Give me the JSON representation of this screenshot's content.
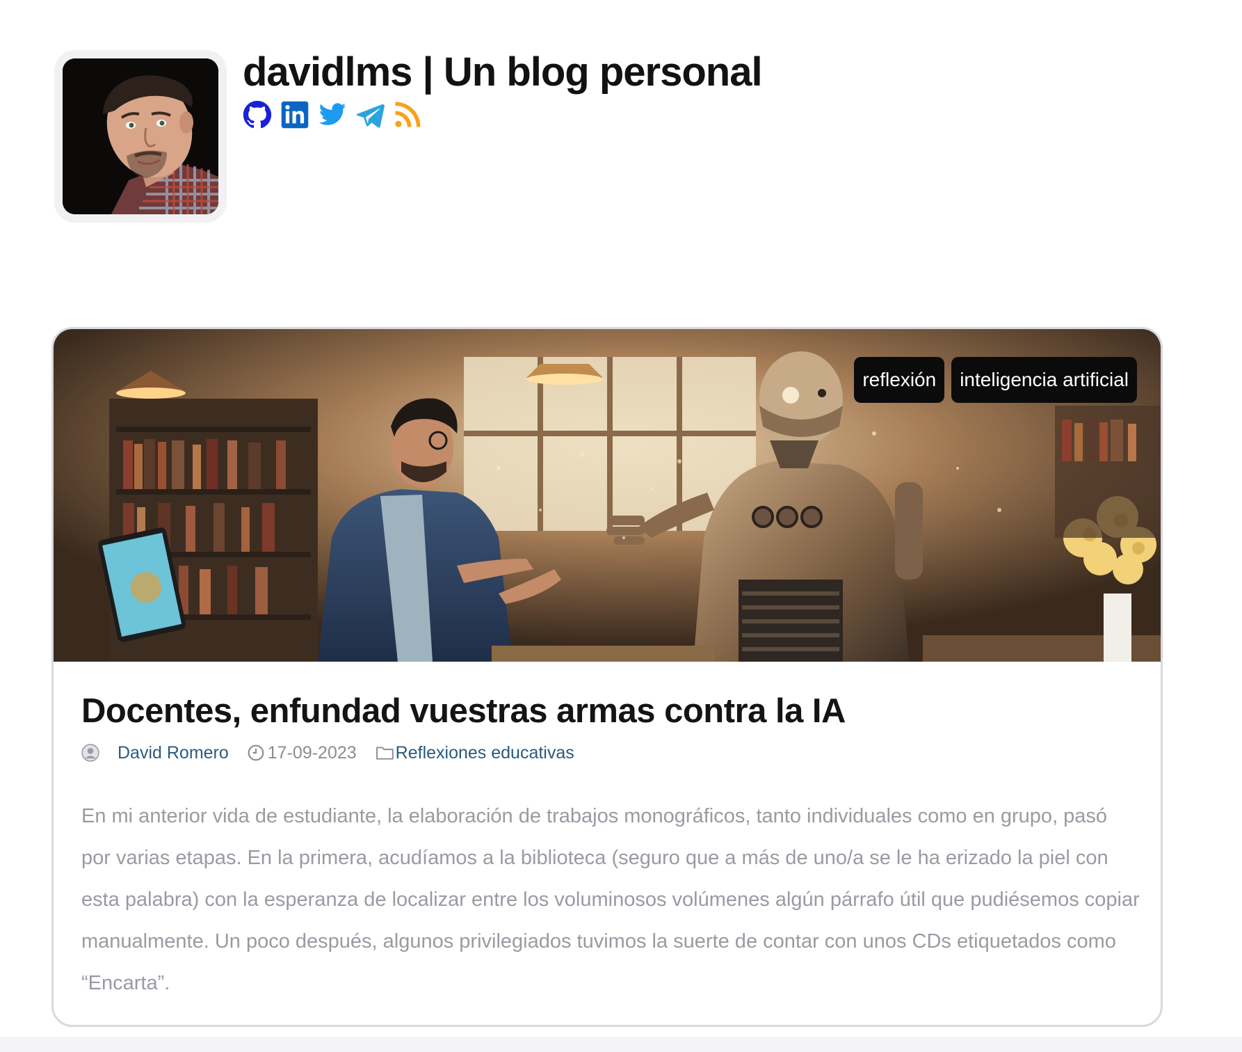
{
  "site": {
    "title": "davidlms | Un blog personal",
    "avatar_alt": "avatar",
    "social": [
      {
        "name": "github-icon",
        "color": "#1a22d6"
      },
      {
        "name": "linkedin-icon",
        "color": "#0a66c2"
      },
      {
        "name": "twitter-icon",
        "color": "#1d9bf0"
      },
      {
        "name": "telegram-icon",
        "color": "#2aa3de"
      },
      {
        "name": "rss-icon",
        "color": "#f6a21e"
      }
    ]
  },
  "post": {
    "tags": [
      "reflexión",
      "inteligencia artificial"
    ],
    "title": "Docentes, enfundad vuestras armas contra la IA",
    "author": "David Romero",
    "date": "17-09-2023",
    "category": "Reflexiones educativas",
    "excerpt": "En mi anterior vida de estudiante, la elaboración de trabajos monográficos, tanto individuales como en grupo, pasó por varias etapas. En la primera, acudíamos a la biblioteca (seguro que a más de uno/a se le ha erizado la piel con esta palabra) con la esperanza de localizar entre los voluminosos volúmenes algún párrafo útil que pudiésemos copiar manualmente. Un poco después, algunos privilegiados tuvimos la suerte de contar con unos CDs etiquetados como “Encarta”."
  },
  "colors": {
    "link": "#2b5a7e",
    "muted_text": "#9a9aa3",
    "tag_bg": "#0b0b0b",
    "card_border": "#d9d9de"
  }
}
